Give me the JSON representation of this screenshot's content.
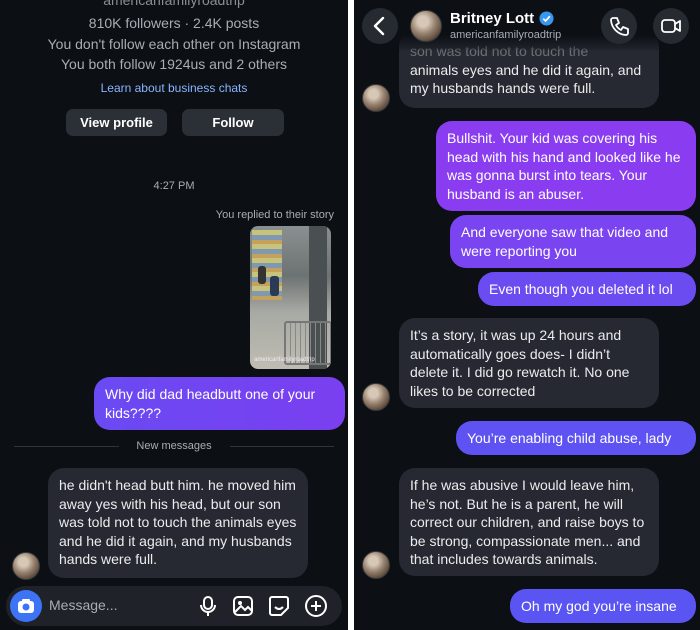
{
  "left": {
    "profile_name": "americanfamilyroadtrip",
    "stats": "810K followers · 2.4K posts",
    "follow_note_1": "You don't follow each other on Instagram",
    "follow_note_2": "You both follow 1924us and 2 others",
    "learn_link": "Learn about business chats",
    "view_profile": "View profile",
    "follow": "Follow",
    "timestamp": "4:27 PM",
    "replied_note": "You replied to their story",
    "story_watermark": "americanfamilyroadtrip",
    "msg_question": "Why did dad headbutt one of your kids????",
    "new_messages": "New messages",
    "msg_reply": "he didn't head butt him. he moved him away yes with his head, but our son was told not to touch the animals eyes and he did it again, and my husbands hands were full.",
    "composer_placeholder": "Message..."
  },
  "right": {
    "name": "Britney Lott",
    "username": "americanfamilyroadtrip",
    "msg_cut_top": "son was told not to touch the",
    "msg_1": "animals eyes and he did it again, and my husbands hands were full.",
    "msg_2": "Bullshit. Your kid was covering his head with his hand and looked like he was gonna burst into tears. Your husband is an abuser.",
    "msg_3": "And everyone saw that video and were reporting you",
    "msg_4": "Even though you deleted it lol",
    "msg_5": "It’s a story, it was up 24 hours and automatically goes does- I didn’t delete it. I did go rewatch it. No one likes to be corrected",
    "msg_6": "You’re enabling child abuse, lady",
    "msg_7": "If he was abusive I would leave him, he’s not. But he is a parent, he will correct our children, and raise boys to be strong, compassionate men... and that includes towards animals.",
    "msg_8": "Oh my god you’re insane"
  },
  "colors": {
    "background": "#0c0f14",
    "incoming_bubble": "#262931",
    "outgoing_purple": "#8a3df0",
    "outgoing_blue": "#5a55f2",
    "link": "#8ab4ff",
    "verified": "#3897f0"
  },
  "icons": [
    "camera-icon",
    "microphone-icon",
    "gallery-icon",
    "sticker-icon",
    "plus-icon",
    "back-chevron-icon",
    "phone-icon",
    "video-icon",
    "verified-badge-icon"
  ]
}
